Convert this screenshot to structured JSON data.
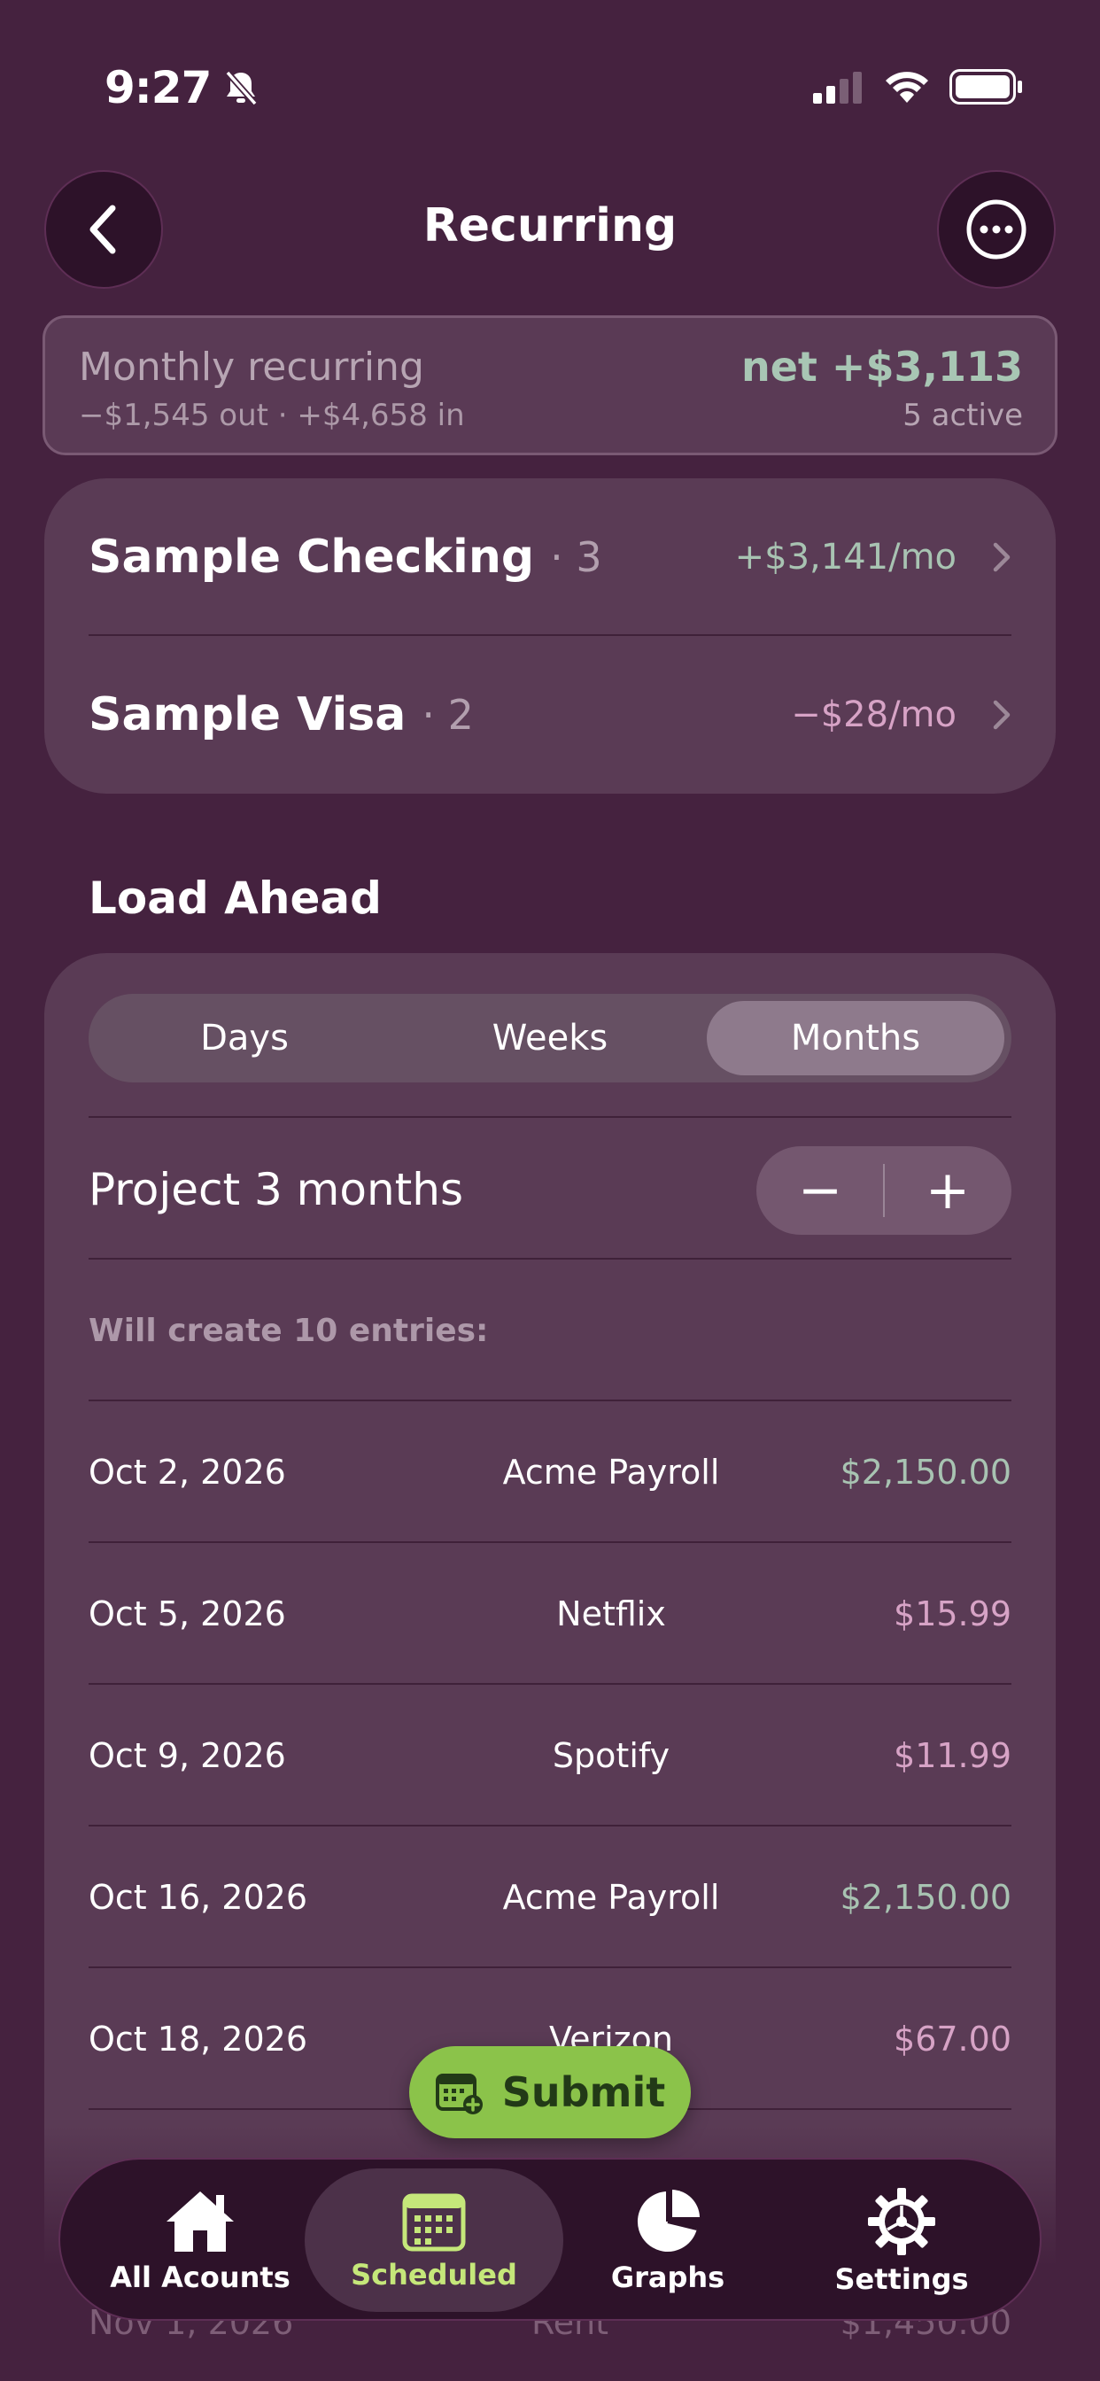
{
  "status_bar": {
    "time": "9:27"
  },
  "nav": {
    "title": "Recurring"
  },
  "summary": {
    "label": "Monthly recurring",
    "flow": "−$1,545 out · +$4,658 in",
    "net": "net +$3,113",
    "active": "5 active"
  },
  "accounts": [
    {
      "name": "Sample Checking",
      "count": "· 3",
      "amount": "+$3,141/mo"
    },
    {
      "name": "Sample Visa",
      "count": "· 2",
      "amount": "−$28/mo"
    }
  ],
  "load_ahead": {
    "title": "Load Ahead",
    "segments": [
      "Days",
      "Weeks",
      "Months"
    ],
    "selected_segment": "Months",
    "project_label": "Project 3 months",
    "minus": "−",
    "plus": "+",
    "will_create": "Will create 10 entries:",
    "entries": [
      {
        "date": "Oct 2, 2026",
        "name": "Acme Payroll",
        "amount": "$2,150.00"
      },
      {
        "date": "Oct 5, 2026",
        "name": "Netflix",
        "amount": "$15.99"
      },
      {
        "date": "Oct 9, 2026",
        "name": "Spotify",
        "amount": "$11.99"
      },
      {
        "date": "Oct 16, 2026",
        "name": "Acme Payroll",
        "amount": "$2,150.00"
      },
      {
        "date": "Oct 18, 2026",
        "name": "Verizon",
        "amount": "$67.00"
      }
    ],
    "peek_entry": {
      "date": "Nov 1, 2026",
      "name": "Rent",
      "amount": "$1,450.00"
    }
  },
  "submit": {
    "label": "Submit"
  },
  "tabs": [
    {
      "label": "All Acounts",
      "icon": "home-icon"
    },
    {
      "label": "Scheduled",
      "icon": "calendar-icon"
    },
    {
      "label": "Graphs",
      "icon": "pie-chart-icon"
    },
    {
      "label": "Settings",
      "icon": "gear-icon"
    }
  ],
  "colors": {
    "background": "#45223f",
    "card": "#5a3b55",
    "positive": "#a8c3b2",
    "negative": "#d7a3c6",
    "accent": "#8bc34a",
    "tab_active": "#c5e77a"
  }
}
